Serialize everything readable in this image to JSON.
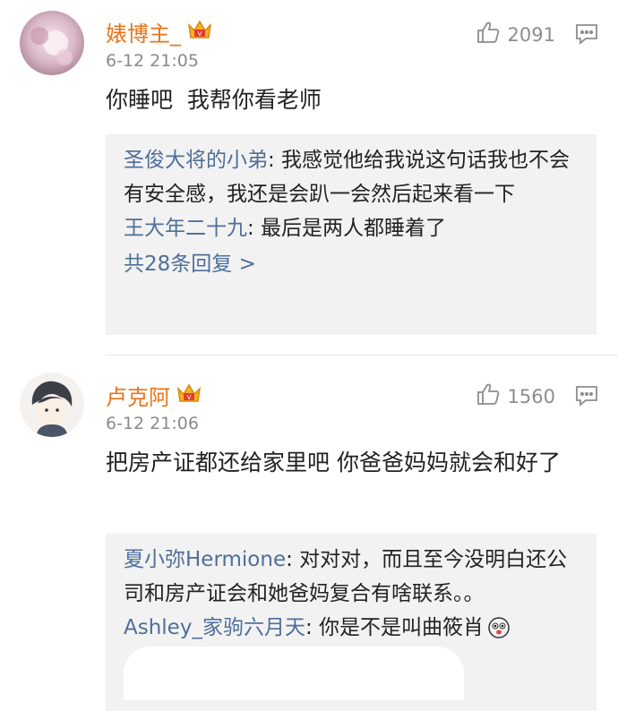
{
  "comments": [
    {
      "username": "婊博主_",
      "time": "6-12 21:05",
      "likes": "2091",
      "text": "你睡吧  我帮你看老师",
      "replies": [
        {
          "name": "圣俊大将的小弟",
          "text": ": 我感觉他给我说这句话我也不会有安全感，我还是会趴一会然后起来看一下"
        },
        {
          "name": "王大年二十九",
          "text": ": 最后是两人都睡着了"
        }
      ],
      "more_replies": "共28条回复 >"
    },
    {
      "username": "卢克阿",
      "time": "6-12 21:06",
      "likes": "1560",
      "text": "把房产证都还给家里吧 你爸爸妈妈就会和好了",
      "replies": [
        {
          "name": "夏小弥Hermione",
          "text": ": 对对对，而且至今没明白还公司和房产证会和她爸妈复合有啥联系。。"
        },
        {
          "name": "Ashley_家驹六月天",
          "text": ": 你是不是叫曲筱肖"
        }
      ]
    }
  ],
  "colors": {
    "username": "#e8741b",
    "reply_name": "#4f6f9a",
    "reply_bg": "#f2f2f2"
  }
}
